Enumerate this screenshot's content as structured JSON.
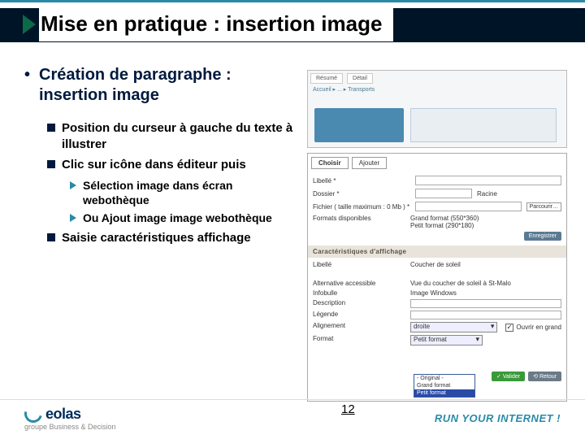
{
  "title": "Mise en pratique : insertion image",
  "bullets": {
    "l1": "Création de paragraphe : insertion image",
    "l2a": "Position du curseur à gauche du texte à illustrer",
    "l2b": "Clic sur icône dans éditeur puis",
    "l3a": "Sélection image dans écran webothèque",
    "l3b": "Ou Ajout image image webothèque",
    "l2c": "Saisie caractéristiques affichage"
  },
  "shot2": {
    "tab_choisir": "Choisir",
    "tab_ajouter": "Ajouter",
    "libelle": "Libellé *",
    "dossier": "Dossier *",
    "racine": "Racine",
    "fichier": "Fichier ( taille maximum : 0 Mb ) *",
    "parcourir": "Parcourir…",
    "formats": "Formats disponibles",
    "formats_val1": "Grand format (550*360)",
    "formats_val2": "Petit format (290*180)",
    "enregistrer": "Enregistrer",
    "section": "Caractéristiques d'affichage",
    "lib2": "Libellé",
    "lib2_val": "Coucher de soleil",
    "alt": "Alternative accessible",
    "alt_val": "Vue du coucher de soleil à St-Malo",
    "infobulle": "Infobulle",
    "infobulle_val": "Image Windows",
    "description": "Description",
    "legende": "Légende",
    "alignement": "Alignement",
    "alignement_val": "droite",
    "ouvrir": "Ouvrir en grand",
    "format": "Format",
    "format_val": "Petit format",
    "opt1": "- Original -",
    "opt2": "Grand format",
    "opt3": "Petit format",
    "valider": "Valider",
    "retour": "Retour"
  },
  "footer": {
    "logo": "eolas",
    "sub": "groupe Business & Decision",
    "page": "12",
    "tagline": "RUN YOUR INTERNET !"
  }
}
